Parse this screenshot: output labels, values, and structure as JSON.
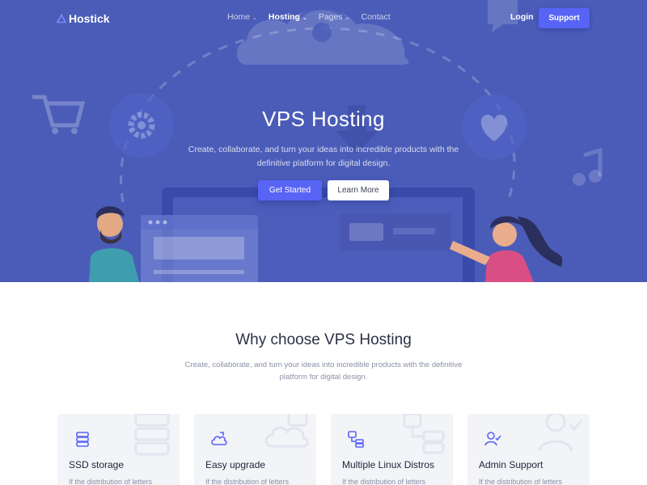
{
  "brand": {
    "name": "Hostick"
  },
  "nav": {
    "items": [
      {
        "label": "Home",
        "has_caret": true,
        "active": false
      },
      {
        "label": "Hosting",
        "has_caret": true,
        "active": true
      },
      {
        "label": "Pages",
        "has_caret": true,
        "active": false
      },
      {
        "label": "Contact",
        "has_caret": false,
        "active": false
      }
    ],
    "login_label": "Login",
    "support_label": "Support"
  },
  "hero": {
    "title": "VPS Hosting",
    "subtitle": "Create, collaborate, and turn your ideas into incredible products with the definitive platform for digital design.",
    "primary_button": "Get Started",
    "secondary_button": "Learn More"
  },
  "why": {
    "title": "Why choose VPS Hosting",
    "subtitle": "Create, collaborate, and turn your ideas into incredible products with the definitive platform for digital design."
  },
  "features": [
    {
      "title": "SSD storage",
      "text": "If the distribution of letters",
      "icon": "server-icon"
    },
    {
      "title": "Easy upgrade",
      "text": "If the distribution of letters",
      "icon": "cloud-icon"
    },
    {
      "title": "Multiple Linux Distros",
      "text": "If the distribution of letters",
      "icon": "network-icon"
    },
    {
      "title": "Admin Support",
      "text": "If the distribution of letters",
      "icon": "user-check-icon"
    }
  ],
  "colors": {
    "hero_bg": "#4b5cb8",
    "accent": "#5864f6",
    "card_bg": "#f3f4f8",
    "heading": "#2c3044",
    "muted": "#8a91a6"
  }
}
